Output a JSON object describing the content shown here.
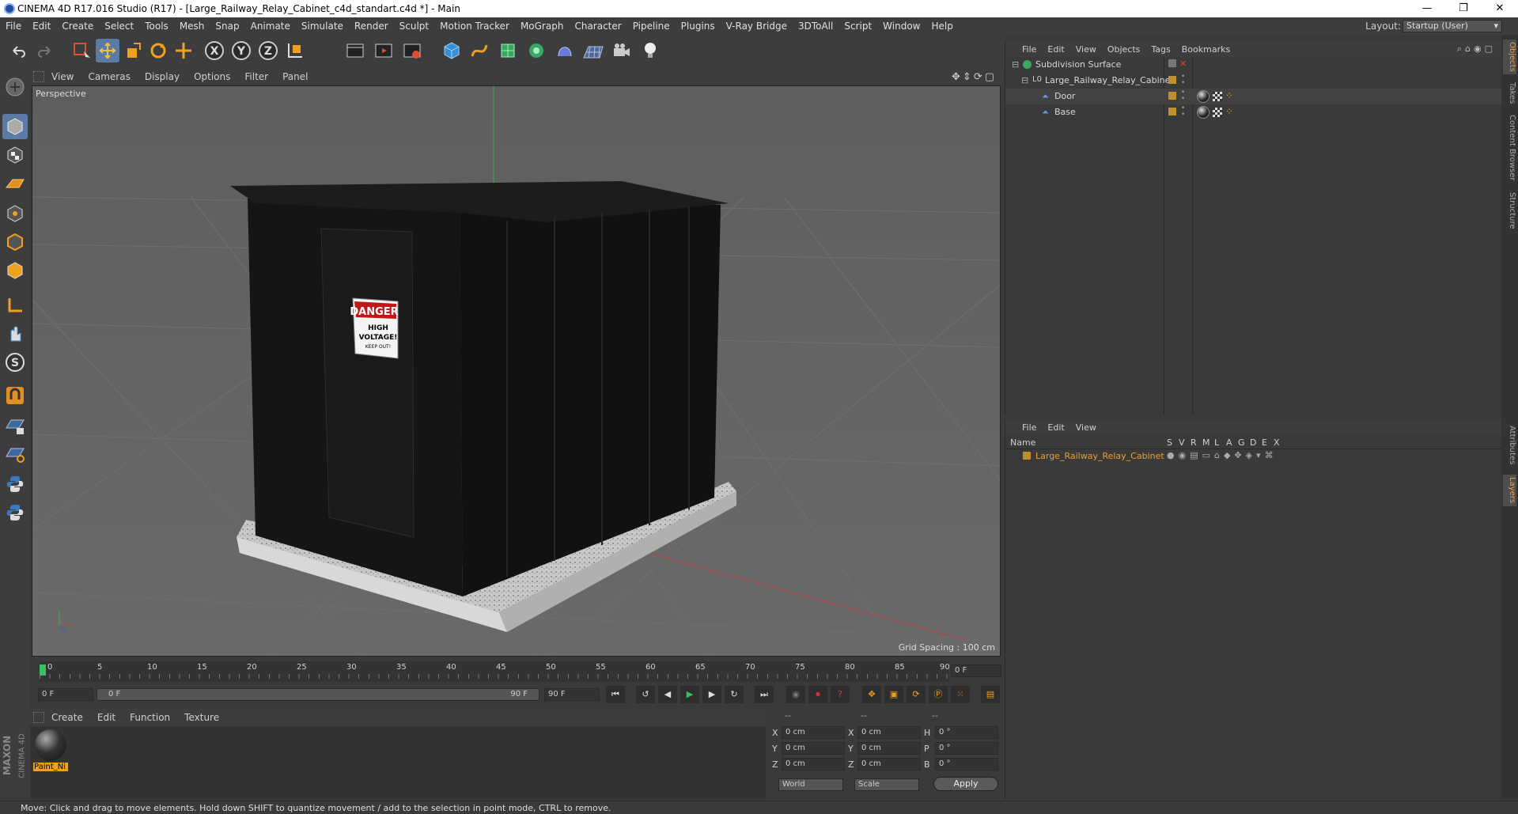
{
  "window": {
    "title": "CINEMA 4D R17.016 Studio (R17) - [Large_Railway_Relay_Cabinet_c4d_standart.c4d *] - Main",
    "minimize": "—",
    "maximize": "❐",
    "close": "✕"
  },
  "menubar": {
    "items": [
      "File",
      "Edit",
      "Create",
      "Select",
      "Tools",
      "Mesh",
      "Snap",
      "Animate",
      "Simulate",
      "Render",
      "Sculpt",
      "Motion Tracker",
      "MoGraph",
      "Character",
      "Pipeline",
      "Plugins",
      "V-Ray Bridge",
      "3DToAll",
      "Script",
      "Window",
      "Help"
    ],
    "layout_label": "Layout:",
    "layout_value": "Startup (User)"
  },
  "toolbar": {
    "icons": [
      "undo-icon",
      "redo-icon",
      "live-selection-icon",
      "move-icon",
      "scale-icon",
      "rotate-icon",
      "move-axis-icon",
      "x-axis-icon",
      "y-axis-icon",
      "z-axis-icon",
      "coordinate-system-icon",
      "render-view-icon",
      "render-picture-viewer-icon",
      "edit-render-settings-icon",
      "cube-icon",
      "pen-icon",
      "subdivision-icon",
      "cloner-icon",
      "deformer-icon",
      "floor-icon",
      "camera-icon",
      "light-icon"
    ],
    "axis": [
      "X",
      "Y",
      "Z"
    ]
  },
  "viewport": {
    "menu": [
      "View",
      "Cameras",
      "Display",
      "Options",
      "Filter",
      "Panel"
    ],
    "label": "Perspective",
    "grid_spacing": "Grid Spacing : 100 cm",
    "sign": {
      "title": "DANGER",
      "line1": "HIGH",
      "line2": "VOLTAGE!",
      "line3": "KEEP OUT!"
    }
  },
  "timeline": {
    "ticks": [
      "0",
      "5",
      "10",
      "15",
      "20",
      "25",
      "30",
      "35",
      "40",
      "45",
      "50",
      "55",
      "60",
      "65",
      "70",
      "75",
      "80",
      "85",
      "90"
    ],
    "frame_field": "0 F"
  },
  "transport": {
    "start": "0 F",
    "slider_start": "0 F",
    "slider_end": "90 F",
    "end": "90 F"
  },
  "material_manager": {
    "menu": [
      "Create",
      "Edit",
      "Function",
      "Texture"
    ],
    "material_name": "Paint_Ni"
  },
  "coordinates": {
    "headers": [
      "--",
      "--",
      "--"
    ],
    "rows": [
      {
        "a": "X",
        "av": "0 cm",
        "b": "X",
        "bv": "0 cm",
        "c": "H",
        "cv": "0 °"
      },
      {
        "a": "Y",
        "av": "0 cm",
        "b": "Y",
        "bv": "0 cm",
        "c": "P",
        "cv": "0 °"
      },
      {
        "a": "Z",
        "av": "0 cm",
        "b": "Z",
        "bv": "0 cm",
        "c": "B",
        "cv": "0 °"
      }
    ],
    "world": "World",
    "scale": "Scale",
    "apply": "Apply"
  },
  "object_manager": {
    "menu": [
      "File",
      "Edit",
      "View",
      "Objects",
      "Tags",
      "Bookmarks"
    ],
    "objects": [
      {
        "name": "Subdivision Surface",
        "indent": 0
      },
      {
        "name": "Large_Railway_Relay_Cabinet",
        "indent": 1
      },
      {
        "name": "Door",
        "indent": 2
      },
      {
        "name": "Base",
        "indent": 2
      }
    ]
  },
  "layer_manager": {
    "menu": [
      "File",
      "Edit",
      "View"
    ],
    "columns": {
      "name": "Name",
      "flags": [
        "S",
        "V",
        "R",
        "M",
        "L",
        "A",
        "G",
        "D",
        "E",
        "X"
      ]
    },
    "layers": [
      {
        "name": "Large_Railway_Relay_Cabinet",
        "color": "#e8a030"
      }
    ]
  },
  "right_tabs": [
    "Objects",
    "Takes",
    "Content Browser",
    "Structure",
    "Attributes",
    "Layers"
  ],
  "status": "Move: Click and drag to move elements. Hold down SHIFT to quantize movement / add to the selection in point mode, CTRL to remove.",
  "brand": {
    "line1": "MAXON",
    "line2": "CINEMA 4D"
  }
}
